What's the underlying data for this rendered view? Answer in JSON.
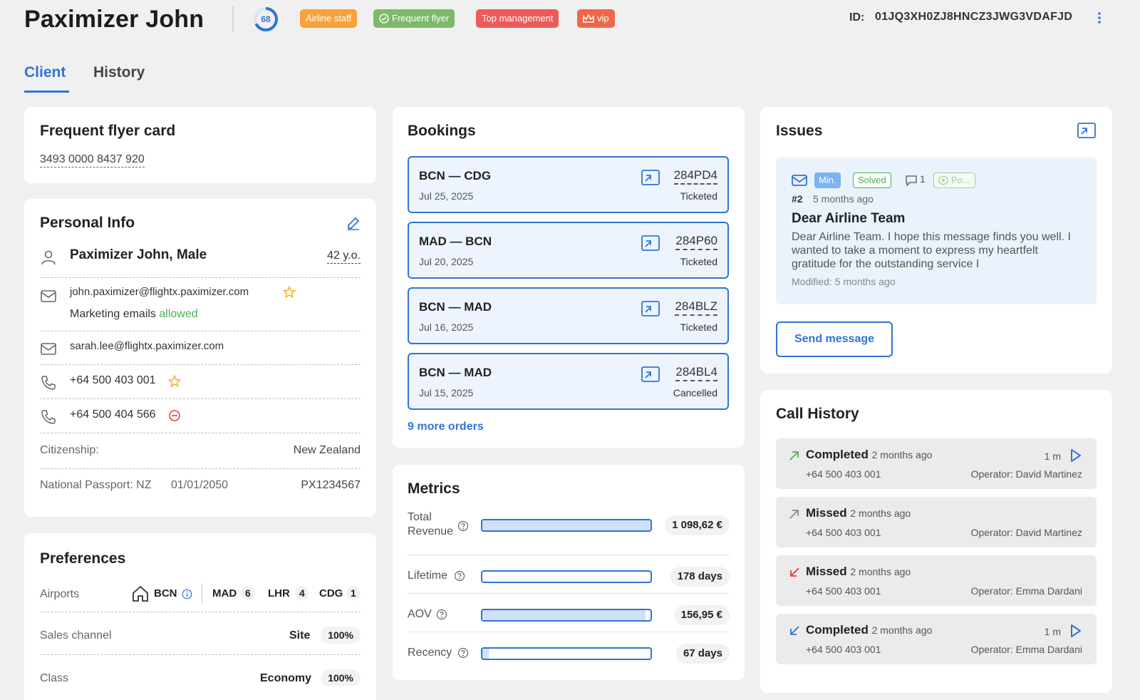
{
  "header": {
    "name": "Paximizer John",
    "score": "68",
    "tags": [
      {
        "label": "Airline staff",
        "color": "#f7a23a"
      },
      {
        "label": "Frequent flyer",
        "color": "#7cba6a"
      },
      {
        "label": "Top management",
        "color": "#ee5a5a"
      },
      {
        "label": "vip",
        "color": "#f0664a"
      }
    ],
    "id_label": "ID:",
    "id_value": "01JQ3XH0ZJ8HNCZ3JWG3VDAFJD"
  },
  "tabs": [
    {
      "label": "Client",
      "active": true
    },
    {
      "label": "History",
      "active": false
    }
  ],
  "frequent_flyer": {
    "title": "Frequent flyer card",
    "number": "3493 0000 8437 920"
  },
  "personal_info": {
    "title": "Personal Info",
    "name_gender": "Paximizer John, Male",
    "age": "42 y.o.",
    "email_primary": "john.paximizer@flightx.paximizer.com",
    "marketing_prefix": "Marketing emails",
    "marketing_status": "allowed",
    "email_secondary": "sarah.lee@flightx.paximizer.com",
    "phone_primary": "+64 500 403 001",
    "phone_secondary": "+64 500 404 566",
    "citizenship_label": "Citizenship:",
    "citizenship_value": "New Zealand",
    "passport_label": "National Passport: NZ",
    "passport_expiry": "01/01/2050",
    "passport_number": "PX1234567"
  },
  "preferences": {
    "title": "Preferences",
    "airports_label": "Airports",
    "home_airport": "BCN",
    "airports": [
      {
        "code": "MAD",
        "count": "6"
      },
      {
        "code": "LHR",
        "count": "4"
      },
      {
        "code": "CDG",
        "count": "1"
      }
    ],
    "sales_channel_label": "Sales channel",
    "sales_channel_value": "Site",
    "sales_channel_pct": "100%",
    "class_label": "Class",
    "class_value": "Economy",
    "class_pct": "100%"
  },
  "bookings": {
    "title": "Bookings",
    "items": [
      {
        "route": "BCN — CDG",
        "date": "Jul 25, 2025",
        "pnr": "284PD4",
        "status": "Ticketed"
      },
      {
        "route": "MAD — BCN",
        "date": "Jul 20, 2025",
        "pnr": "284P60",
        "status": "Ticketed"
      },
      {
        "route": "BCN — MAD",
        "date": "Jul 16, 2025",
        "pnr": "284BLZ",
        "status": "Ticketed"
      },
      {
        "route": "BCN — MAD",
        "date": "Jul 15, 2025",
        "pnr": "284BL4",
        "status": "Cancelled"
      }
    ],
    "more": "9 more orders"
  },
  "metrics": {
    "title": "Metrics",
    "items": [
      {
        "label": "Total Revenue",
        "value": "1 098,62 €",
        "fill": 1.0
      },
      {
        "label": "Lifetime",
        "value": "178 days",
        "fill": 0.0
      },
      {
        "label": "AOV",
        "value": "156,95 €",
        "fill": 0.97
      },
      {
        "label": "Recency",
        "value": "67 days",
        "fill": 0.04
      }
    ]
  },
  "issues": {
    "title": "Issues",
    "badge_priority": "Min.",
    "badge_status": "Solved",
    "comments": "1",
    "badge_po": "Po...",
    "number": "#2",
    "ago": "5 months ago",
    "subject": "Dear Airline Team",
    "body": "Dear Airline Team. I hope this message finds you well. I wanted to take a moment to express my heartfelt gratitude for the outstanding service I",
    "modified": "Modified: 5 months ago",
    "send_button": "Send message"
  },
  "calls": {
    "title": "Call History",
    "items": [
      {
        "type": "Completed",
        "ago": "2 months ago",
        "phone": "+64 500 403 001",
        "operator": "Operator: David Martinez",
        "duration": "1 m",
        "direction": "outgoing",
        "color": "#4caf50"
      },
      {
        "type": "Missed",
        "ago": "2 months ago",
        "phone": "+64 500 403 001",
        "operator": "Operator: David Martinez",
        "duration": "",
        "direction": "outgoing",
        "color": "#888888"
      },
      {
        "type": "Missed",
        "ago": "2 months ago",
        "phone": "+64 500 403 001",
        "operator": "Operator: Emma Dardani",
        "duration": "",
        "direction": "incoming",
        "color": "#e53935"
      },
      {
        "type": "Completed",
        "ago": "2 months ago",
        "phone": "+64 500 403 001",
        "operator": "Operator: Emma Dardani",
        "duration": "1 m",
        "direction": "incoming",
        "color": "#2f74d6"
      }
    ]
  }
}
